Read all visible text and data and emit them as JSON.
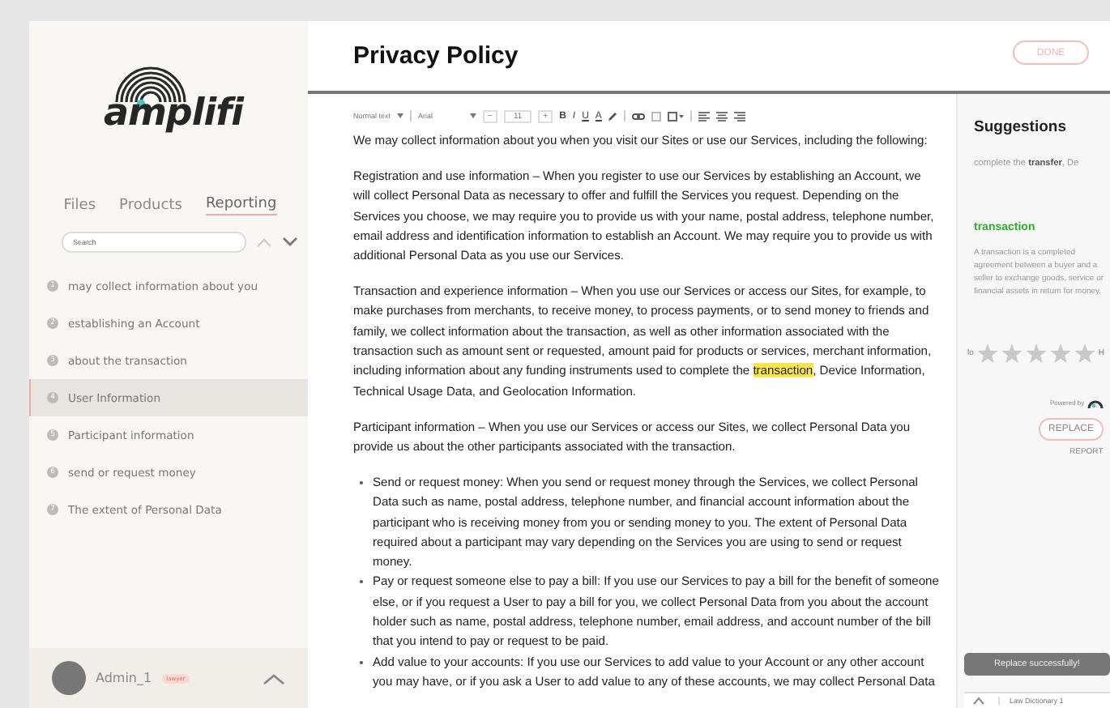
{
  "sidebar": {
    "logo": "amplifi",
    "tabs": [
      {
        "label": "Files",
        "selected": false
      },
      {
        "label": "Products",
        "selected": false
      },
      {
        "label": "Reporting",
        "selected": true
      }
    ],
    "search": {
      "placeholder": "Search"
    },
    "items": [
      {
        "number": "1",
        "label": "may collect information about you",
        "selected": false
      },
      {
        "number": "2",
        "label": "establishing an Account",
        "selected": false
      },
      {
        "number": "3",
        "label": "about the transaction",
        "selected": false
      },
      {
        "number": "4",
        "label": "User Information",
        "selected": true
      },
      {
        "number": "5",
        "label": "Participant information",
        "selected": false
      },
      {
        "number": "6",
        "label": "send or request money",
        "selected": false
      },
      {
        "number": "7",
        "label": "The extent of Personal Data",
        "selected": false
      }
    ],
    "user": {
      "name": "Admin_1",
      "badge": "lawyer"
    }
  },
  "document": {
    "title": "Privacy Policy",
    "done_button": "DONE",
    "toolbar": {
      "style": "Normal text",
      "font": "Arial",
      "minus": "−",
      "size": "11",
      "plus": "+",
      "bold": "B",
      "italic": "I",
      "underline": "U",
      "font_color": "A"
    },
    "blocks": [
      {
        "kind": "paragraph",
        "text": "We may collect information about you when you visit our Sites or use our Services, including the following:"
      },
      {
        "kind": "paragraph",
        "text": "Registration and use information – When you register to use our Services by establishing an Account, we will collect Personal Data as necessary to offer and fulfill the Services you request. Depending on the Services you choose, we may require you to provide us with your name, postal address, telephone number, email address and identification information to establish an Account. We may require you to provide us with additional Personal Data as you use our Services."
      },
      {
        "kind": "paragraph",
        "text": "Transaction and experience information – When you use our Services or access our Sites, for example, to make purchases from merchants, to receive money, to process payments, or to send money to friends and family, we collect information about the transaction, as well as other information associated with the transaction such as amount sent or requested, amount paid for products or services, merchant information, including information about any funding instruments used to complete the ",
        "highlight": "transaction",
        "text_after": ", Device Information, Technical Usage Data, and Geolocation Information."
      },
      {
        "kind": "paragraph",
        "text": "Participant information – When you use our Services or access our Sites, we collect Personal Data you provide us about the other participants associated with the transaction."
      },
      {
        "kind": "bullet",
        "text": "Send or request money: When you send or request money through the Services, we collect Personal Data such as name, postal address, telephone number, and financial account information about the participant who is receiving money from you or sending money to you. The extent of Personal Data required about a participant may vary depending on the Services you are using to send or request money."
      },
      {
        "kind": "bullet",
        "text": "Pay or request someone else to pay a bill: If you use our Services to pay a bill for the benefit of someone else, or if you request a User to pay a bill for you, we collect Personal Data from you about the account holder such as name, postal address, telephone number, email address, and account number of the bill that you intend to pay or request to be paid."
      },
      {
        "kind": "bullet",
        "text": "Add value to your accounts: If you use our Services to add value to your Account or any other account you may have, or if you ask a User to add value to any of these accounts, we may collect Personal Data"
      }
    ]
  },
  "suggestions": {
    "title": "Suggestions",
    "preview": "complete the **transfer**, De",
    "term": "transaction",
    "definition": "A transaction is a completed agreement between a buyer and a seller to exchange goods, service or financial assets in return for money.",
    "rating_low": "lo",
    "rating_high": "H",
    "stars": 0,
    "powered_by": "Powered by",
    "replace_button": "REPLACE",
    "report_link": "REPORT",
    "toast": "Replace successfully!",
    "dictionary": "Law Dictionary 1"
  }
}
